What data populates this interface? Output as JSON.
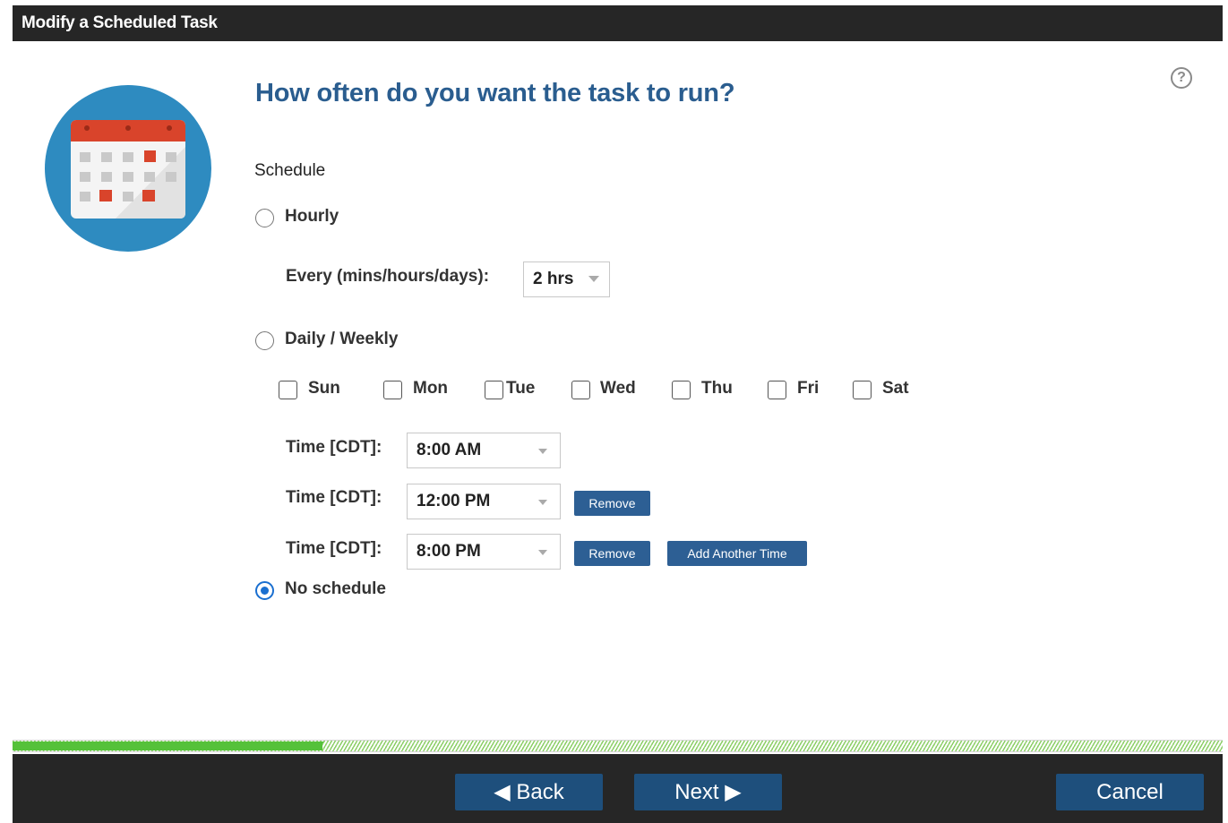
{
  "window": {
    "title": "Modify a Scheduled Task"
  },
  "main": {
    "heading": "How often do you want the task to run?",
    "schedule_label": "Schedule",
    "options": {
      "hourly": {
        "label": "Hourly",
        "selected": false
      },
      "daily_weekly": {
        "label": "Daily / Weekly",
        "selected": false
      },
      "no_schedule": {
        "label": "No schedule",
        "selected": true
      }
    },
    "hourly": {
      "every_label": "Every (mins/hours/days):",
      "every_value": "2 hrs"
    },
    "days": [
      {
        "label": "Sun",
        "checked": false
      },
      {
        "label": "Mon",
        "checked": false
      },
      {
        "label": "Tue",
        "checked": false
      },
      {
        "label": "Wed",
        "checked": false
      },
      {
        "label": "Thu",
        "checked": false
      },
      {
        "label": "Fri",
        "checked": false
      },
      {
        "label": "Sat",
        "checked": false
      }
    ],
    "times": [
      {
        "label": "Time [CDT]:",
        "value": "8:00 AM"
      },
      {
        "label": "Time [CDT]:",
        "value": "12:00 PM",
        "remove_label": "Remove"
      },
      {
        "label": "Time [CDT]:",
        "value": "8:00 PM",
        "remove_label": "Remove",
        "add_label": "Add Another Time"
      }
    ]
  },
  "help_icon": "?",
  "footer": {
    "back_label": "◀ Back",
    "next_label": "Next ▶",
    "cancel_label": "Cancel"
  },
  "colors": {
    "title_bar": "#262626",
    "heading": "#2a5d8f",
    "button": "#2d5f94",
    "progress": "#55c13a",
    "radio_selected": "#1a6fd0"
  }
}
